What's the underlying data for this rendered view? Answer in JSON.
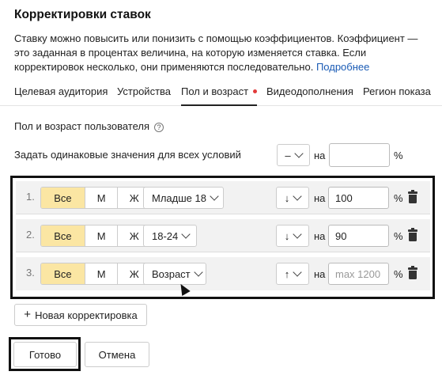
{
  "header": {
    "title": "Корректировки ставок",
    "description": "Ставку можно повысить или понизить с помощью коэффициентов. Коэффициент — это заданная в процентах величина, на которую изменяется ставка. Если корректировок несколько, они применяются последовательно.",
    "more_link": "Подробнее"
  },
  "tabs": [
    {
      "label": "Целевая аудитория",
      "active": false
    },
    {
      "label": "Устройства",
      "active": false
    },
    {
      "label": "Пол и возраст",
      "active": true
    },
    {
      "label": "Видеодополнения",
      "active": false
    },
    {
      "label": "Регион показа",
      "active": false
    }
  ],
  "section": {
    "title": "Пол и возраст пользователя",
    "help_icon": "?"
  },
  "same_values": {
    "label": "Задать одинаковые значения для всех условий",
    "sign": "–",
    "on_label": "на",
    "value": "",
    "percent": "%"
  },
  "rows": [
    {
      "num": "1.",
      "gender": [
        "Все",
        "М",
        "Ж"
      ],
      "gender_selected": "Все",
      "age": "Младше 18",
      "direction": "↓",
      "on_label": "на",
      "value": "100",
      "placeholder": "",
      "percent": "%"
    },
    {
      "num": "2.",
      "gender": [
        "Все",
        "М",
        "Ж"
      ],
      "gender_selected": "Все",
      "age": "18-24",
      "direction": "↓",
      "on_label": "на",
      "value": "90",
      "placeholder": "",
      "percent": "%"
    },
    {
      "num": "3.",
      "gender": [
        "Все",
        "М",
        "Ж"
      ],
      "gender_selected": "Все",
      "age": "Возраст",
      "direction": "↑",
      "on_label": "на",
      "value": "",
      "placeholder": "max 1200",
      "percent": "%"
    }
  ],
  "buttons": {
    "add": "Новая корректировка",
    "add_icon": "+",
    "done": "Готово",
    "cancel": "Отмена"
  },
  "colors": {
    "selected_segment": "#fbe6a3",
    "active_dot": "#e23a3a",
    "link": "#1a5bb5"
  }
}
